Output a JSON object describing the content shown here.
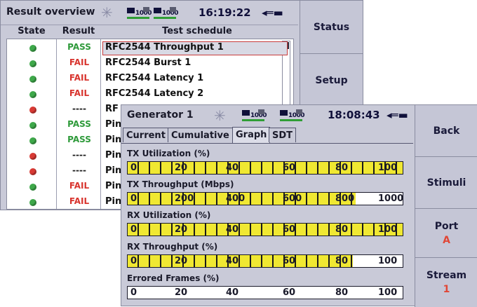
{
  "colors": {
    "pass": "#2e9a3a",
    "fail": "#d8342e",
    "green_dot": "#3ea84a",
    "red_dot": "#d83a34",
    "gauge_fill": "#f0e832",
    "port": "#e04636"
  },
  "overview": {
    "title": "Result overview",
    "clock": "16:19:22",
    "link1": "1000",
    "link2": "1000",
    "columns": {
      "state": "State",
      "result": "Result",
      "schedule": "Test schedule"
    },
    "rows": [
      {
        "state": "green",
        "result": "PASS",
        "schedule": "RFC2544 Throughput 1"
      },
      {
        "state": "green",
        "result": "FAIL",
        "schedule": "RFC2544 Burst 1"
      },
      {
        "state": "green",
        "result": "FAIL",
        "schedule": "RFC2544 Latency 1"
      },
      {
        "state": "green",
        "result": "FAIL",
        "schedule": "RFC2544 Latency 2"
      },
      {
        "state": "red",
        "result": "----",
        "schedule": "RF"
      },
      {
        "state": "green",
        "result": "PASS",
        "schedule": "Pin"
      },
      {
        "state": "green",
        "result": "PASS",
        "schedule": "Pin"
      },
      {
        "state": "red",
        "result": "----",
        "schedule": "Pin"
      },
      {
        "state": "red",
        "result": "----",
        "schedule": "Pin"
      },
      {
        "state": "green",
        "result": "FAIL",
        "schedule": "Pin"
      },
      {
        "state": "green",
        "result": "FAIL",
        "schedule": "Pin"
      }
    ],
    "buttons": [
      "Status",
      "Setup"
    ]
  },
  "generator": {
    "title": "Generator 1",
    "clock": "18:08:43",
    "link1": "1000",
    "link2": "1000",
    "tabs": [
      "Current",
      "Cumulative",
      "Graph",
      "SDT"
    ],
    "active_tab": "Graph",
    "gauges": [
      {
        "label": "TX Utilization (%)",
        "ticks": [
          "0",
          "20",
          "40",
          "60",
          "80",
          "100"
        ],
        "level": 1.0
      },
      {
        "label": "TX Throughput (Mbps)",
        "ticks": [
          "0",
          "200",
          "400",
          "600",
          "800",
          "1000"
        ],
        "level": 0.83
      },
      {
        "label": "RX Utilization (%)",
        "ticks": [
          "0",
          "20",
          "40",
          "60",
          "80",
          "100"
        ],
        "level": 1.0
      },
      {
        "label": "RX Throughput (%)",
        "ticks": [
          "0",
          "20",
          "40",
          "60",
          "80",
          "100"
        ],
        "level": 0.82
      },
      {
        "label": "Errored Frames (%)",
        "ticks": [
          "0",
          "20",
          "40",
          "60",
          "80",
          "100"
        ],
        "level": 0.0
      }
    ],
    "buttons": {
      "back": "Back",
      "stimuli": "Stimuli",
      "port_label": "Port",
      "port_value": "A",
      "stream_label": "Stream",
      "stream_value": "1"
    }
  }
}
